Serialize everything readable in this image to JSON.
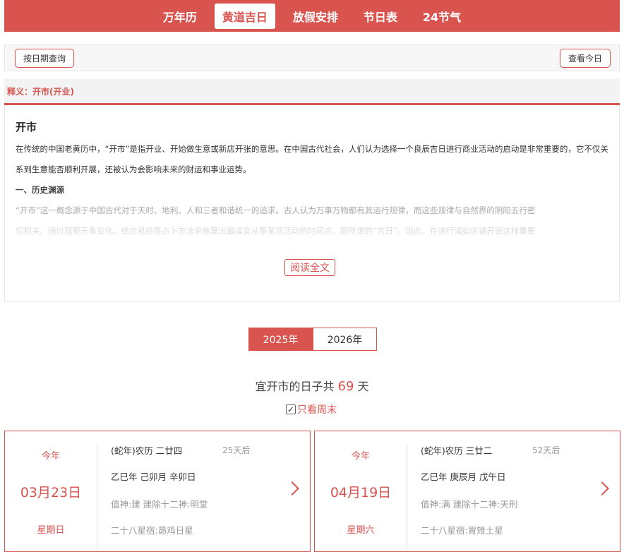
{
  "nav": {
    "tabs": [
      {
        "label": "万年历"
      },
      {
        "label": "黄道吉日"
      },
      {
        "label": "放假安排"
      },
      {
        "label": "节日表"
      },
      {
        "label": "24节气"
      }
    ],
    "active_index": 1
  },
  "toolbar": {
    "query_by_date": "按日期查询",
    "view_today": "查看今日"
  },
  "meaning": {
    "heading": "释义：开市(开业)"
  },
  "article": {
    "title": "开市",
    "para1": "在传统的中国老黄历中，“开市”是指开业、开始做生意或新店开张的意思。在中国古代社会，人们认为选择一个良辰吉日进行商业活动的启动是非常重要的，它不仅关系到生意能否顺利开展，还被认为会影响未来的财运和事业运势。",
    "section1": "一、历史渊源",
    "para2a": "“开市”这一概念源于中国古代对于天时、地利、人和三者和谐统一的追求。古人认为万事万物都有其运行规律，而这些规律与自然界的阴阳五行密",
    "para2b": "切相关。通过观察天象变化，结合易经等占卜方法来推算出最适宜从事某项活动的时间点，即所谓的“吉日”。因此，在进行诸如店铺开张这样重要",
    "read_more": "阅读全文"
  },
  "year_tabs": [
    {
      "label": "2025年"
    },
    {
      "label": "2026年"
    }
  ],
  "summary": {
    "prefix": "宜开市的日子共",
    "count": "69",
    "suffix": "天"
  },
  "filter": {
    "weekend_only_label": "只看周末",
    "weekend_only_checked": true
  },
  "cards": [
    {
      "top_label": "今年",
      "date": "03月23日",
      "weekday": "星期日",
      "lunar": "(蛇年)农历 二廿四",
      "days_after": "25天后",
      "ganzhi": "乙巳年 己卯月 辛卯日",
      "shen": "值神:建   建除十二神:明堂",
      "xiu": "二十八星宿:昴鸡日星"
    },
    {
      "top_label": "今年",
      "date": "04月19日",
      "weekday": "星期六",
      "lunar": "(蛇年)农历 三廿二",
      "days_after": "52天后",
      "ganzhi": "乙巳年 庚辰月 戊午日",
      "shen": "值神:满   建除十二神:天刑",
      "xiu": "二十八星宿:胃雉土星"
    }
  ],
  "colors": {
    "accent": "#d9534f"
  },
  "icons": {
    "next": "chevron-right-icon",
    "checkbox": "checkbox-checked-icon"
  }
}
